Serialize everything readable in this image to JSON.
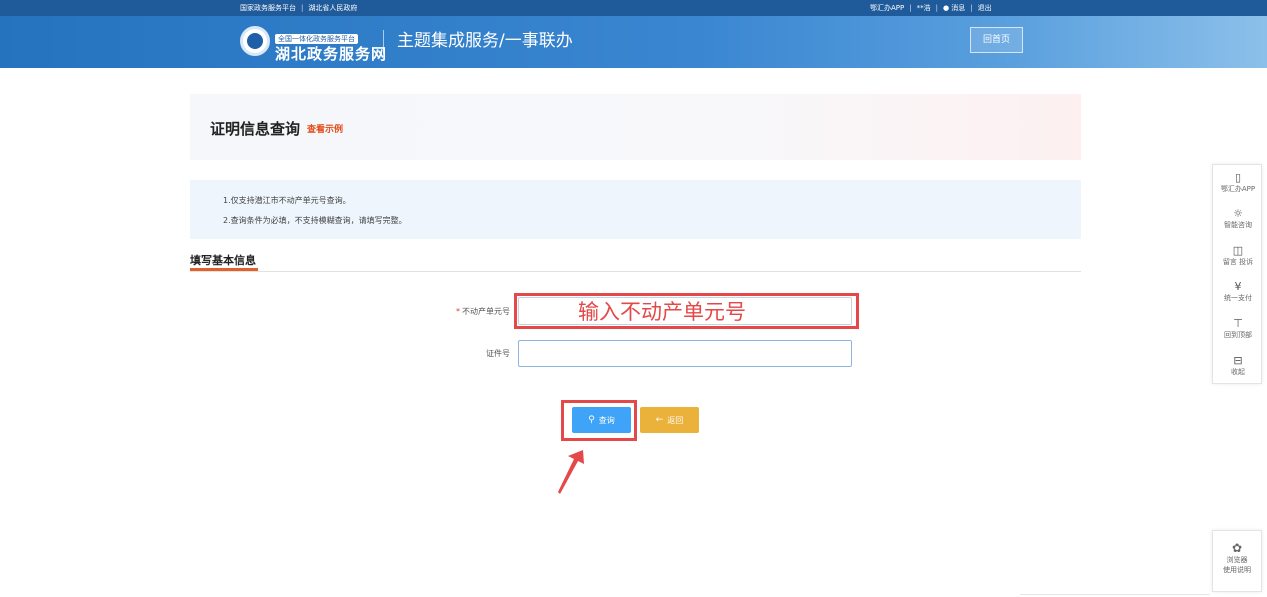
{
  "topbar": {
    "left_links": [
      "国家政务服务平台",
      "湖北省人民政府"
    ],
    "right_links": [
      "鄂汇办APP",
      "**浩",
      "消息",
      "退出"
    ]
  },
  "header": {
    "logo_small": "全国一体化政务服务平台",
    "logo_big": "湖北政务服务网",
    "title": "主题集成服务/一事联办",
    "home_button": "回首页"
  },
  "page": {
    "title": "证明信息查询",
    "example_link": "查看示例"
  },
  "notice": {
    "line1": "1.仅支持潜江市不动产单元号查询。",
    "line2": "2.查询条件为必填，不支持模糊查询，请填写完整。"
  },
  "section": {
    "tab": "填写基本信息"
  },
  "form": {
    "required_mark": "*",
    "unit_label": "不动产单元号",
    "unit_value": "",
    "id_label": "证件号",
    "id_value": ""
  },
  "annotation": {
    "text": "输入不动产单元号"
  },
  "buttons": {
    "query": "查询",
    "back": "返回"
  },
  "float_bar": [
    {
      "icon": "phone-icon",
      "label": "鄂汇办APP"
    },
    {
      "icon": "headset-icon",
      "label": "智能咨询"
    },
    {
      "icon": "message-icon",
      "label": "留言 投诉"
    },
    {
      "icon": "yen-icon",
      "label": "统一支付"
    },
    {
      "icon": "to-top-icon",
      "label": "回到顶部"
    },
    {
      "icon": "collapse-icon",
      "label": "收起"
    }
  ],
  "browser_help": {
    "line1": "浏览器",
    "line2": "使用说明"
  },
  "colors": {
    "header_blue": "#2573bf",
    "accent_orange": "#e0622a",
    "query_blue": "#3fa3f7",
    "back_yellow": "#eab23a",
    "annotation_red": "#e54848"
  }
}
